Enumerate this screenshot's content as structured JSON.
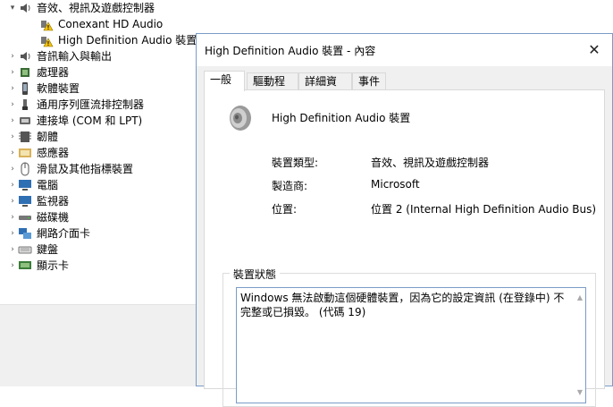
{
  "tree": {
    "items": [
      {
        "label": "音效、視訊及遊戲控制器",
        "icon": "speaker-icon",
        "expanded": true
      },
      {
        "label": "Conexant HD Audio",
        "icon": "warning-icon",
        "child": true
      },
      {
        "label": "High Definition Audio 裝置",
        "icon": "warning-icon",
        "child": true
      },
      {
        "label": "音訊輸入與輸出",
        "icon": "speaker-icon"
      },
      {
        "label": "處理器",
        "icon": "cpu-icon"
      },
      {
        "label": "軟體裝置",
        "icon": "device-icon"
      },
      {
        "label": "通用序列匯流排控制器",
        "icon": "usb-icon"
      },
      {
        "label": "連接埠 (COM 和 LPT)",
        "icon": "port-icon"
      },
      {
        "label": "韌體",
        "icon": "chip-icon"
      },
      {
        "label": "感應器",
        "icon": "sensor-icon"
      },
      {
        "label": "滑鼠及其他指標裝置",
        "icon": "mouse-icon"
      },
      {
        "label": "電腦",
        "icon": "monitor-icon"
      },
      {
        "label": "監視器",
        "icon": "monitor-icon"
      },
      {
        "label": "磁碟機",
        "icon": "disk-icon"
      },
      {
        "label": "網路介面卡",
        "icon": "network-icon"
      },
      {
        "label": "鍵盤",
        "icon": "keyboard-icon"
      },
      {
        "label": "顯示卡",
        "icon": "display-adapter-icon"
      }
    ]
  },
  "dialog": {
    "title": "High Definition Audio 裝置 - 內容",
    "close_symbol": "✕",
    "tabs": [
      {
        "label": "一般",
        "active": true
      },
      {
        "label": "驅動程式"
      },
      {
        "label": "詳細資料"
      },
      {
        "label": "事件"
      }
    ],
    "device_name": "High Definition Audio 裝置",
    "properties": [
      {
        "label": "裝置類型:",
        "value": "音效、視訊及遊戲控制器"
      },
      {
        "label": "製造商:",
        "value": "Microsoft"
      },
      {
        "label": "位置:",
        "value": "位置 2 (Internal High Definition Audio Bus)"
      }
    ],
    "status_group_label": "裝置狀態",
    "status_text": "Windows 無法啟動這個硬體裝置，因為它的設定資訊 (在登錄中) 不完整或已損毀。 (代碼 19)"
  }
}
